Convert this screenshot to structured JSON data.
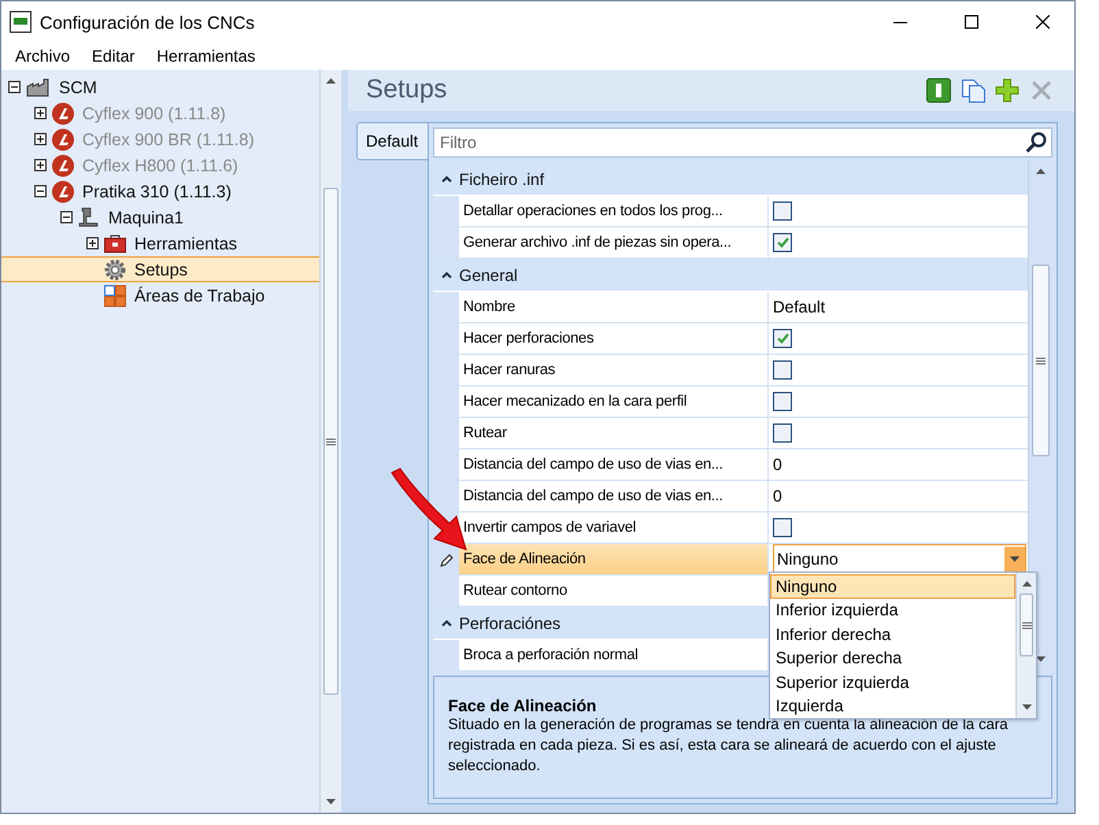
{
  "window": {
    "title": "Configuración de los CNCs"
  },
  "menu": [
    "Archivo",
    "Editar",
    "Herramientas"
  ],
  "tree": [
    {
      "label": "SCM",
      "kind": "factory",
      "expanded": true,
      "disabled": false,
      "selected": false,
      "children": [
        {
          "label": "Cyflex 900 (1.11.8)",
          "kind": "brand",
          "expanded": false,
          "disabled": true,
          "selected": false
        },
        {
          "label": "Cyflex 900 BR (1.11.8)",
          "kind": "brand",
          "expanded": false,
          "disabled": true,
          "selected": false
        },
        {
          "label": "Cyflex H800 (1.11.6)",
          "kind": "brand",
          "expanded": false,
          "disabled": true,
          "selected": false
        },
        {
          "label": "Pratika 310 (1.11.3)",
          "kind": "brand",
          "expanded": true,
          "disabled": false,
          "selected": false,
          "children": [
            {
              "label": "Maquina1",
              "kind": "machine",
              "expanded": true,
              "disabled": false,
              "selected": false,
              "children": [
                {
                  "label": "Herramientas",
                  "kind": "toolbox",
                  "expanded": false,
                  "disabled": false,
                  "selected": false
                },
                {
                  "label": "Setups",
                  "kind": "gear",
                  "disabled": false,
                  "selected": true
                },
                {
                  "label": "Áreas de Trabajo",
                  "kind": "areas",
                  "disabled": false,
                  "selected": false
                }
              ]
            }
          ]
        }
      ]
    }
  ],
  "panel": {
    "title": "Setups",
    "tools": [
      {
        "kind": "info",
        "disabled": false
      },
      {
        "kind": "copy",
        "disabled": false
      },
      {
        "kind": "add",
        "disabled": false
      },
      {
        "kind": "delete",
        "disabled": true
      }
    ]
  },
  "tabs": [
    {
      "label": "Default",
      "selected": true
    }
  ],
  "filter": {
    "placeholder": "Filtro"
  },
  "categories": [
    {
      "name": "Ficheiro .inf",
      "expanded": true,
      "rows": [
        {
          "label": "Detallar operaciones en todos los prog...",
          "kind": "check",
          "checked": false,
          "selected": false
        },
        {
          "label": "Generar archivo .inf de piezas sin opera...",
          "kind": "check",
          "checked": true,
          "selected": false
        }
      ]
    },
    {
      "name": "General",
      "expanded": true,
      "rows": [
        {
          "label": "Nombre",
          "kind": "text",
          "value": "Default",
          "selected": false
        },
        {
          "label": "Hacer perforaciones",
          "kind": "check",
          "checked": true,
          "selected": false
        },
        {
          "label": "Hacer ranuras",
          "kind": "check",
          "checked": false,
          "selected": false
        },
        {
          "label": "Hacer mecanizado en la cara perfil",
          "kind": "check",
          "checked": false,
          "selected": false
        },
        {
          "label": "Rutear",
          "kind": "check",
          "checked": false,
          "selected": false
        },
        {
          "label": "Distancia del campo de uso de vias en...",
          "kind": "text",
          "value": "0",
          "selected": false
        },
        {
          "label": "Distancia del campo de uso de vias en...",
          "kind": "text",
          "value": "0",
          "selected": false
        },
        {
          "label": "Invertir campos de variavel",
          "kind": "check",
          "checked": false,
          "selected": false
        },
        {
          "label": "Face de Alineación",
          "kind": "dropdown",
          "value": "Ninguno",
          "selected": true
        },
        {
          "label": "Rutear contorno",
          "kind": "text",
          "selected": false
        }
      ]
    },
    {
      "name": "Perforaciónes",
      "expanded": true,
      "rows": [
        {
          "label": "Broca a perforación normal",
          "kind": "text",
          "selected": false
        }
      ]
    }
  ],
  "dropdown": {
    "options": [
      {
        "label": "Ninguno",
        "selected": true
      },
      {
        "label": "Inferior izquierda",
        "selected": false
      },
      {
        "label": "Inferior derecha",
        "selected": false
      },
      {
        "label": "Superior derecha",
        "selected": false
      },
      {
        "label": "Superior izquierda",
        "selected": false
      },
      {
        "label": "Izquierda",
        "selected": false
      }
    ]
  },
  "description": {
    "title": "Face de Alineación",
    "text": "Situado en la generación de programas se tendrá en cuenta la alineación de la cara registrada en cada pieza. Si es así, esta cara se alineará de acuerdo con el ajuste seleccionado."
  }
}
